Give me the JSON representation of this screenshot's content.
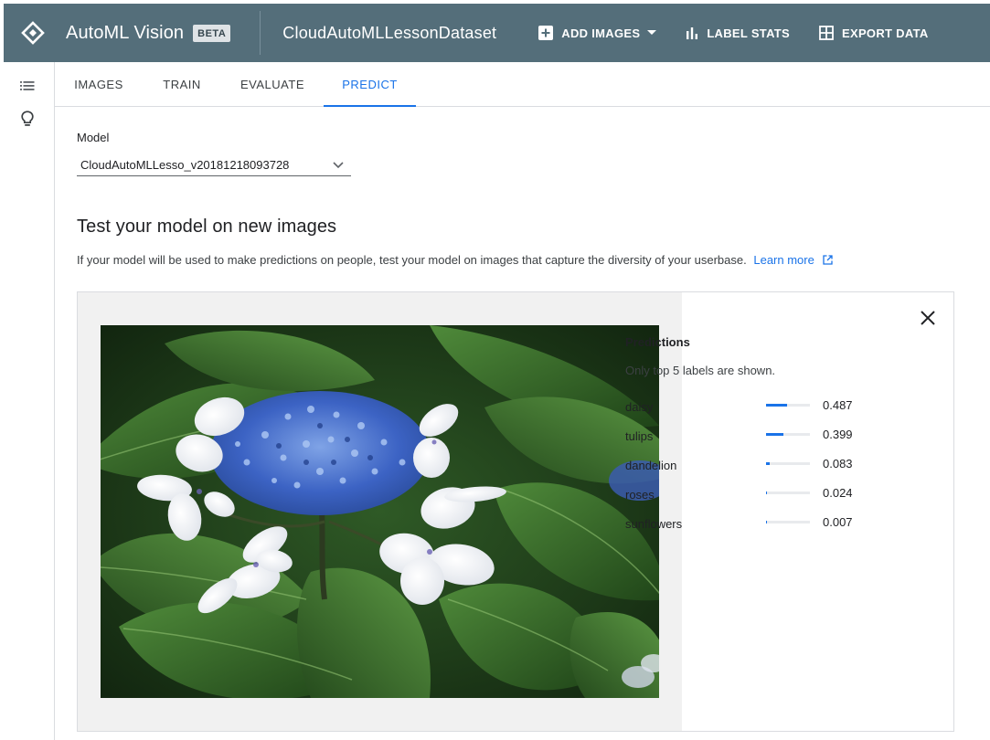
{
  "header": {
    "app_title": "AutoML Vision",
    "badge": "BETA",
    "dataset_name": "CloudAutoMLLessonDataset",
    "actions": [
      {
        "label": "ADD IMAGES",
        "icon": "add-box-icon",
        "has_dropdown": true
      },
      {
        "label": "LABEL STATS",
        "icon": "bar-chart-icon",
        "has_dropdown": false
      },
      {
        "label": "EXPORT DATA",
        "icon": "grid-icon",
        "has_dropdown": false
      }
    ],
    "bg_color": "#546e7a"
  },
  "rail": {
    "items": [
      {
        "icon": "list-icon"
      },
      {
        "icon": "lightbulb-icon"
      }
    ]
  },
  "tabs": [
    {
      "label": "IMAGES",
      "active": false
    },
    {
      "label": "TRAIN",
      "active": false
    },
    {
      "label": "EVALUATE",
      "active": false
    },
    {
      "label": "PREDICT",
      "active": true
    }
  ],
  "model": {
    "label": "Model",
    "selected": "CloudAutoMLLesso_v20181218093728"
  },
  "section": {
    "title": "Test your model on new images",
    "description": "If your model will be used to make predictions on people, test your model on images that capture the diversity of your userbase.",
    "link_text": "Learn more"
  },
  "predictions": {
    "title": "Predictions",
    "note": "Only top 5 labels are shown.",
    "items": [
      {
        "label": "daisy",
        "score": "0.487",
        "fraction": 0.487
      },
      {
        "label": "tulips",
        "score": "0.399",
        "fraction": 0.399
      },
      {
        "label": "dandelion",
        "score": "0.083",
        "fraction": 0.083
      },
      {
        "label": "roses",
        "score": "0.024",
        "fraction": 0.024
      },
      {
        "label": "sunflowers",
        "score": "0.007",
        "fraction": 0.007
      }
    ]
  },
  "accent_color": "#1a73e8"
}
